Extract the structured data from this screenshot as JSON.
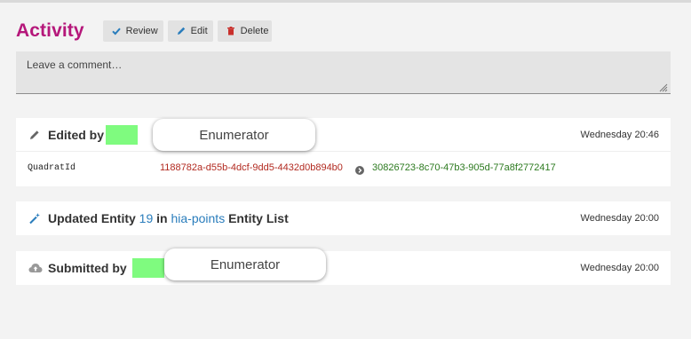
{
  "header": {
    "title": "Activity",
    "buttons": {
      "review": "Review",
      "edit": "Edit",
      "delete": "Delete"
    }
  },
  "comment": {
    "placeholder": "Leave a comment…"
  },
  "feed": [
    {
      "icon": "pencil-icon",
      "label": "Edited by",
      "user_label": "Enumerator",
      "time": "Wednesday 20:46",
      "change": {
        "field": "QuadratId",
        "old_value": "1188782a-d55b-4dcf-9dd5-4432d0b894b0",
        "new_value": "30826723-8c70-47b3-905d-77a8f2772417"
      }
    },
    {
      "icon": "magic-wand-icon",
      "label_prefix": "Updated Entity",
      "entity_number": "19",
      "label_in": "in",
      "list_name": "hia-points",
      "label_suffix": "Entity List",
      "time": "Wednesday 20:00"
    },
    {
      "icon": "cloud-upload-icon",
      "label": "Submitted by",
      "user_label": "Enumerator",
      "time": "Wednesday 20:00"
    }
  ],
  "colors": {
    "title": "#b5177a",
    "link": "#2a7dbc",
    "old_value": "#b22a20",
    "new_value": "#2c7a1f",
    "user_swatch": "#7ffb7f"
  }
}
